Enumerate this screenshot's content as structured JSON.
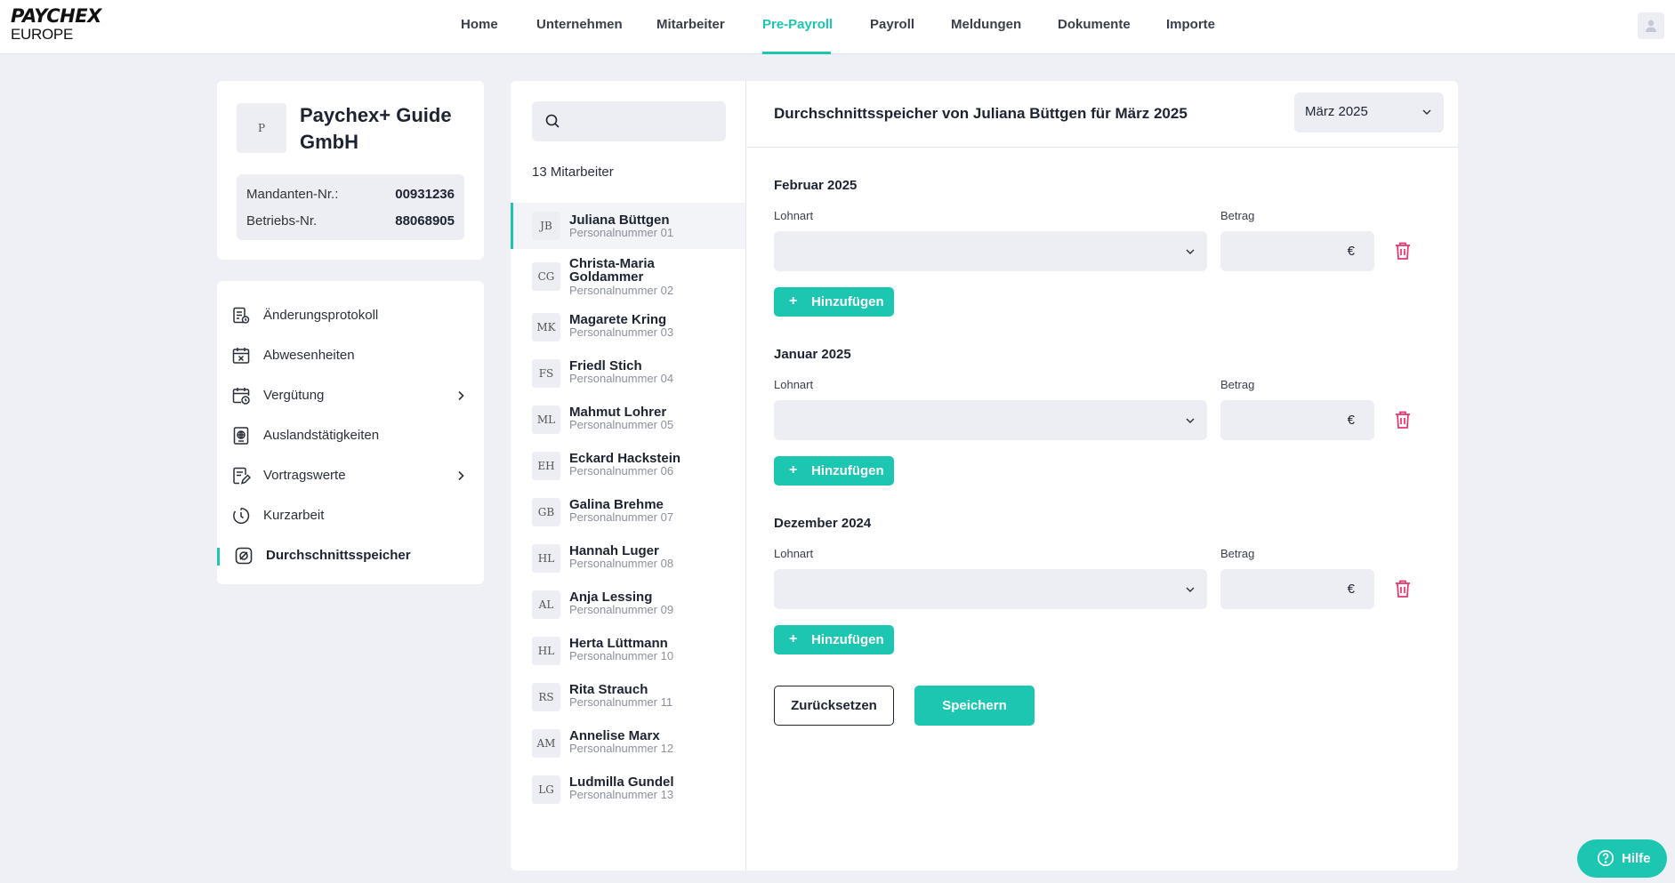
{
  "logo": {
    "line1": "PAYCHEX",
    "line2": "EUROPE"
  },
  "nav": {
    "items": [
      {
        "label": "Home"
      },
      {
        "label": "Unternehmen"
      },
      {
        "label": "Mitarbeiter"
      },
      {
        "label": "Pre-Payroll",
        "active": true
      },
      {
        "label": "Payroll"
      },
      {
        "label": "Meldungen"
      },
      {
        "label": "Dokumente"
      },
      {
        "label": "Importe"
      }
    ]
  },
  "company": {
    "logo_initial": "P",
    "name": "Paychex+ Guide GmbH",
    "mandanten_label": "Mandanten-Nr.:",
    "mandanten_value": "00931236",
    "betriebs_label": "Betriebs-Nr.",
    "betriebs_value": "88068905"
  },
  "menu": {
    "items": [
      {
        "label": "Änderungsprotokoll",
        "icon": "log-icon"
      },
      {
        "label": "Abwesenheiten",
        "icon": "calendar-x-icon"
      },
      {
        "label": "Vergütung",
        "icon": "calendar-clock-icon",
        "has_chevron": true
      },
      {
        "label": "Auslandstätigkeiten",
        "icon": "globe-passport-icon"
      },
      {
        "label": "Vortragswerte",
        "icon": "edit-document-icon",
        "has_chevron": true
      },
      {
        "label": "Kurzarbeit",
        "icon": "clock-icon"
      },
      {
        "label": "Durchschnittsspeicher",
        "icon": "average-icon",
        "active": true
      }
    ]
  },
  "employees": {
    "search_placeholder": "",
    "count_label": "13 Mitarbeiter",
    "list": [
      {
        "initials": "JB",
        "name": "Juliana Büttgen",
        "number": "Personalnummer 01",
        "active": true
      },
      {
        "initials": "CG",
        "name": "Christa-Maria Goldammer",
        "number": "Personalnummer 02"
      },
      {
        "initials": "MK",
        "name": "Magarete Kring",
        "number": "Personalnummer 03"
      },
      {
        "initials": "FS",
        "name": "Friedl Stich",
        "number": "Personalnummer 04"
      },
      {
        "initials": "ML",
        "name": "Mahmut Lohrer",
        "number": "Personalnummer 05"
      },
      {
        "initials": "EH",
        "name": "Eckard Hackstein",
        "number": "Personalnummer 06"
      },
      {
        "initials": "GB",
        "name": "Galina Brehme",
        "number": "Personalnummer 07"
      },
      {
        "initials": "HL",
        "name": "Hannah Luger",
        "number": "Personalnummer 08"
      },
      {
        "initials": "AL",
        "name": "Anja Lessing",
        "number": "Personalnummer 09"
      },
      {
        "initials": "HL",
        "name": "Herta Lüttmann",
        "number": "Personalnummer 10"
      },
      {
        "initials": "RS",
        "name": "Rita Strauch",
        "number": "Personalnummer 11"
      },
      {
        "initials": "AM",
        "name": "Annelise Marx",
        "number": "Personalnummer 12"
      },
      {
        "initials": "LG",
        "name": "Ludmilla Gundel",
        "number": "Personalnummer 13"
      }
    ]
  },
  "form": {
    "title": "Durchschnittsspeicher von Juliana Büttgen für März 2025",
    "month_selected": "März 2025",
    "lohnart_label": "Lohnart",
    "betrag_label": "Betrag",
    "currency": "€",
    "add_label": "Hinzufügen",
    "sections": [
      {
        "title": "Februar 2025",
        "lohnart": "",
        "betrag": ""
      },
      {
        "title": "Januar 2025",
        "lohnart": "",
        "betrag": ""
      },
      {
        "title": "Dezember 2024",
        "lohnart": "",
        "betrag": ""
      }
    ],
    "reset_label": "Zurücksetzen",
    "save_label": "Speichern"
  },
  "help": {
    "label": "Hilfe"
  },
  "colors": {
    "accent": "#1dc6b1",
    "danger": "#e8336b",
    "background": "#eef0f5"
  }
}
